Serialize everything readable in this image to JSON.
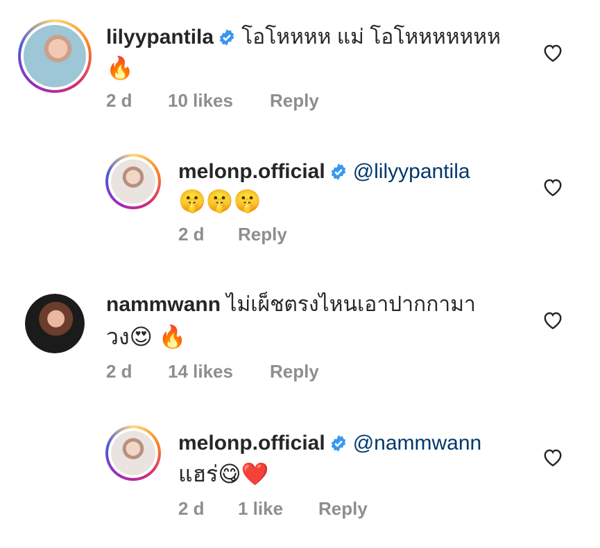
{
  "comments": [
    {
      "username": "lilyypantila",
      "text1": "โอโหหหห แม่ โอโหหหหหหห",
      "text2": "🔥",
      "time": "2 d",
      "likes": "10 likes",
      "reply": "Reply"
    },
    {
      "username": "melonp.official",
      "mention": "@lilyypantila",
      "text2": "🤫🤫🤫",
      "time": "2 d",
      "reply": "Reply"
    },
    {
      "username": "nammwann",
      "text1": "ไม่เผ็ชตรงไหนเอาปากกามา",
      "text2": "วง😍 🔥",
      "time": "2 d",
      "likes": "14 likes",
      "reply": "Reply"
    },
    {
      "username": "melonp.official",
      "mention": "@nammwann",
      "text2": "แฮร่😋❤️",
      "time": "2 d",
      "likes": "1 like",
      "reply": "Reply"
    }
  ],
  "colors": {
    "verified": "#3897f0",
    "mention": "#00376b",
    "meta": "#8e8e8e"
  },
  "icons": {
    "like": "heart-outline-icon",
    "verified": "verified-badge-icon"
  }
}
